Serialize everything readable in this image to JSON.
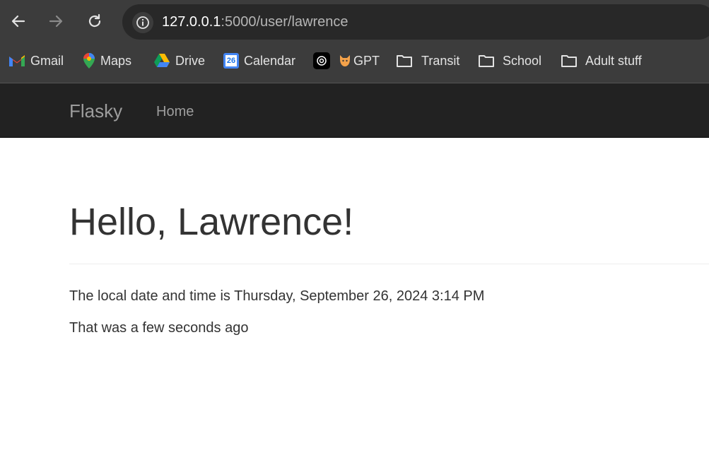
{
  "browser": {
    "url_host": "127.0.0.1",
    "url_rest": ":5000/user/lawrence",
    "bookmarks": [
      {
        "label": "Gmail",
        "icon": "gmail-icon"
      },
      {
        "label": "Maps",
        "icon": "maps-icon"
      },
      {
        "label": "Drive",
        "icon": "drive-icon"
      },
      {
        "label": "Calendar",
        "icon": "calendar-icon",
        "badge": "26"
      },
      {
        "label": "",
        "icon": "chatgpt-icon"
      },
      {
        "label": "GPT",
        "icon": "cat-icon"
      },
      {
        "label": "Transit",
        "icon": "folder-icon"
      },
      {
        "label": "School",
        "icon": "folder-icon"
      },
      {
        "label": "Adult stuff",
        "icon": "folder-icon"
      }
    ]
  },
  "navbar": {
    "brand": "Flasky",
    "home": "Home"
  },
  "main": {
    "title": "Hello, Lawrence!",
    "local_time": "The local date and time is Thursday, September 26, 2024 3:14 PM",
    "ago": "That was a few seconds ago"
  },
  "colors": {
    "chrome_bg": "#3c3c3c",
    "navbar_bg": "#222222",
    "nav_text": "#9d9d9d",
    "body_text": "#333333"
  }
}
